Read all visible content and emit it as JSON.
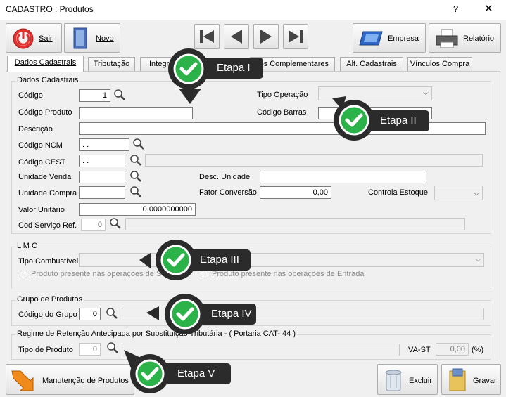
{
  "window": {
    "title": "CADASTRO : Produtos",
    "help": "?",
    "close": "✕"
  },
  "toolbar": {
    "sair": "Sair",
    "novo": "Novo",
    "empresa": "Empresa",
    "relatorio": "Relatório"
  },
  "tabs": [
    "Dados Cadastrais",
    "Tributação",
    "Integr",
    "os Complementares",
    "Alt. Cadastrais",
    "Vínculos Compra"
  ],
  "dados": {
    "title": "Dados Cadastrais",
    "codigo": "Código",
    "codigo_value": "1",
    "codigo_produto": "Código Produto",
    "tipo_operacao": "Tipo Operação",
    "codigo_barras": "Código Barras",
    "descricao": "Descrição",
    "ncm": "Código NCM",
    "ncm_value": " .  .",
    "cest": "Código CEST",
    "cest_value": " .  .",
    "unidade_venda": "Unidade Venda",
    "desc_unidade": "Desc. Unidade",
    "unidade_compra": "Unidade Compra",
    "fator_conversao": "Fator Conversão",
    "fator_value": "0,00",
    "controla_estoque": "Controla Estoque",
    "valor_unitario": "Valor Unitário",
    "valor_value": "0,0000000000",
    "cod_servico": "Cod Serviço Ref.",
    "cod_servico_value": "0"
  },
  "lmc": {
    "title": "L M C",
    "tipo_combustivel": "Tipo Combustível",
    "check1": "Produto presente nas operações de S",
    "check2": "Produto presente nas operações de Entrada"
  },
  "grupo": {
    "title": "Grupo de Produtos",
    "codigo_grupo": "Código do Grupo",
    "value": "0"
  },
  "regime": {
    "title": "Regime de Retenção Antecipada por Substituição Tributária - ( Portaria CAT- 44 )",
    "tipo_produto": "Tipo de Produto",
    "tipo_value": "0",
    "iva_st": "IVA-ST",
    "iva_value": "0,00",
    "pct": "(%)"
  },
  "bottom": {
    "manutencao": "Manutenção de Produtos",
    "excluir": "Excluir",
    "gravar": "Gravar"
  },
  "callouts": [
    "Etapa I",
    "Etapa II",
    "Etapa III",
    "Etapa IV",
    "Etapa V"
  ],
  "colors": {
    "callout_bg": "#2b2b2b",
    "check_green": "#2bb34a",
    "sair_red": "#e0312f"
  }
}
